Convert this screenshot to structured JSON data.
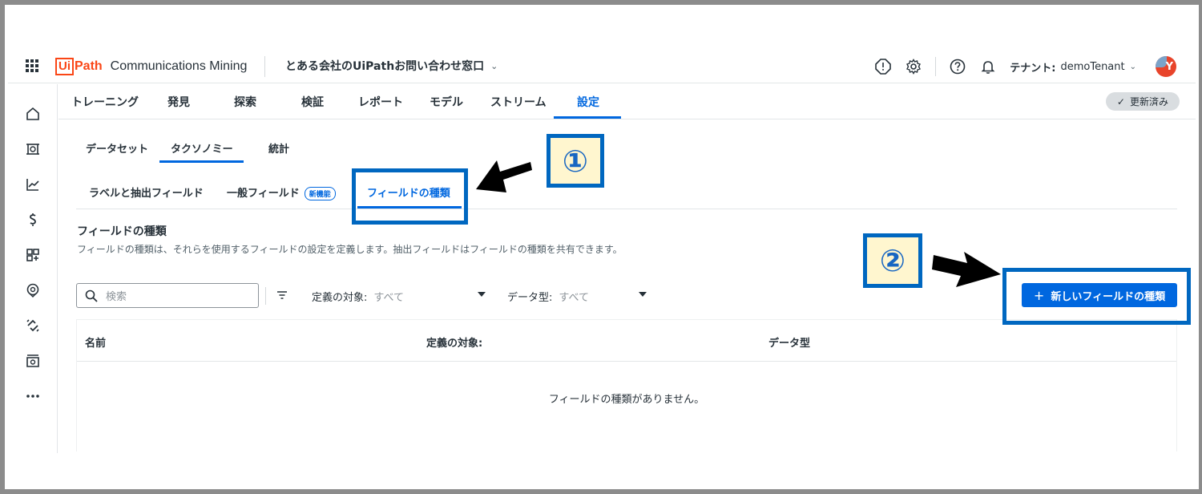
{
  "header": {
    "logo_ui": "Ui",
    "logo_path": "Path",
    "product": "Communications Mining",
    "project": "とある会社のUiPathお問い合わせ窓口",
    "tenant_label": "テナント:",
    "tenant_name": "demoTenant",
    "avatar_initial": "Y"
  },
  "main_tabs": [
    "トレーニング",
    "発見",
    "探索",
    "検証",
    "レポート",
    "モデル",
    "ストリーム",
    "設定"
  ],
  "active_main_tab": "設定",
  "refresh_label": "更新済み",
  "sub_tabs": [
    "データセット",
    "タクソノミー",
    "統計"
  ],
  "active_sub_tab": "タクソノミー",
  "sub_tabs2": [
    "ラベルと抽出フィールド",
    "一般フィールド",
    "フィールドの種類"
  ],
  "new_badge": "新機能",
  "active_sub_tab2": "フィールドの種類",
  "section": {
    "title": "フィールドの種類",
    "description": "フィールドの種類は、それらを使用するフィールドの設定を定義します。抽出フィールドはフィールドの種類を共有できます。"
  },
  "search": {
    "placeholder": "検索"
  },
  "filters": [
    {
      "label": "定義の対象:",
      "value": "すべて"
    },
    {
      "label": "データ型:",
      "value": "すべて"
    }
  ],
  "new_button": "新しいフィールドの種類",
  "table": {
    "columns": [
      "名前",
      "定義の対象:",
      "データ型"
    ],
    "empty_text": "フィールドの種類がありません。"
  },
  "annotations": [
    "①",
    "②"
  ],
  "colors": {
    "accent": "#0067df",
    "logo": "#fa4616",
    "annotation": "#0067c0",
    "annotation_fill": "#fff6cf"
  },
  "icons": {
    "left_nav": [
      "home-icon",
      "train-icon",
      "chart-icon",
      "dollar-icon",
      "apps-icon",
      "location-icon",
      "integrations-icon",
      "store-icon",
      "more-icon"
    ],
    "header": [
      "grid-icon",
      "alert-icon",
      "gear-icon",
      "help-icon",
      "bell-icon"
    ]
  }
}
